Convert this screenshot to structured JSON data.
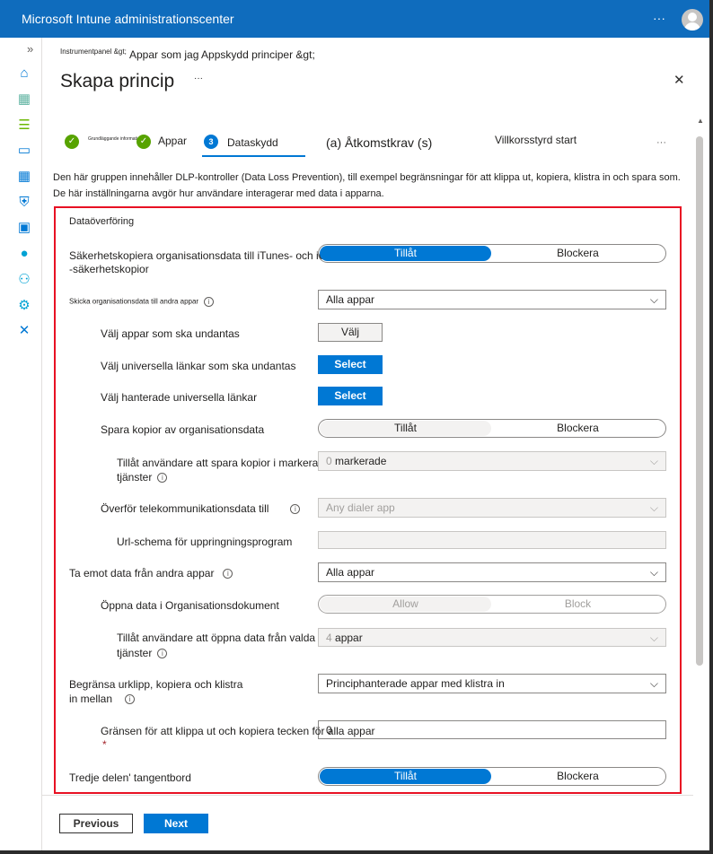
{
  "app": {
    "title": "Microsoft Intune administrationscenter",
    "more": "···"
  },
  "sidebar": {
    "expand": "»",
    "items": [
      "home-icon",
      "dashboard-icon",
      "all-services-icon",
      "devices-icon",
      "apps-icon",
      "endpoint-security-icon",
      "reports-icon",
      "users-icon",
      "groups-icon",
      "tenant-admin-icon",
      "troubleshooting-icon"
    ]
  },
  "breadcrumb": {
    "root": "Instrumentpanel &gt;",
    "path": "Appar som jag Appskydd principer &gt;"
  },
  "page": {
    "title": "Skapa princip",
    "more": "···",
    "close": "✕"
  },
  "steps": [
    {
      "label": "Grundläggande information",
      "state": "done"
    },
    {
      "label": "Appar",
      "state": "done"
    },
    {
      "number": "3",
      "label": "Dataskydd",
      "state": "current"
    },
    {
      "label": "(a)  Åtkomstkrav (s)",
      "state": "pending"
    },
    {
      "label": "Villkorsstyrd start",
      "state": "pending"
    }
  ],
  "steps_more": "···",
  "description": "Den här gruppen innehåller DLP-kontroller (Data Loss Prevention), till exempel begränsningar för att klippa ut, kopiera, klistra in och spara som. De här inställningarna avgör hur användare interagerar med data i apparna.",
  "section": {
    "title": "Dataöverföring"
  },
  "settings": {
    "backup": {
      "label1": "Säkerhetskopiera organisationsdata till iTunes- och iCloud",
      "label2": "-säkerhetskopior",
      "allow": "Tillåt",
      "block": "Blockera",
      "selected": "allow"
    },
    "send": {
      "label": "Skicka organisationsdata till andra appar",
      "value": "Alla appar"
    },
    "exempt": {
      "label": "Välj appar som ska undantas",
      "button": "Välj"
    },
    "universal": {
      "label": "Välj universella länkar som ska undantas",
      "button": "Select"
    },
    "managed": {
      "label": "Välj hanterade universella länkar",
      "button": "Select"
    },
    "save": {
      "label": "Spara kopior av organisationsdata",
      "allow": "Tillåt",
      "block": "Blockera",
      "selected": "allow"
    },
    "save_services": {
      "label1": "Tillåt användare att spara kopior i markerade",
      "label2": "tjänster",
      "count": "0",
      "value": "markerade"
    },
    "telecom": {
      "label": "Överför telekommunikationsdata till",
      "value": "Any dialer app"
    },
    "url_scheme": {
      "label": "Url-schema för uppringningsprogram",
      "value": ""
    },
    "receive": {
      "label": "Ta emot data från andra appar",
      "value": "Alla appar"
    },
    "open": {
      "label": "Öppna data i Organisationsdokument",
      "allow": "Allow",
      "block": "Block",
      "selected": "allow"
    },
    "open_services": {
      "label1": "Tillåt användare att öppna data från valda",
      "label2": "tjänster",
      "count": "4",
      "value": "appar"
    },
    "clipboard": {
      "label1": "Begränsa urklipp, kopiera och klistra",
      "label2": "in mellan",
      "value": "Principhanterade appar med klistra in"
    },
    "limit": {
      "label": "Gränsen för att klippa ut och kopiera tecken för alla appar",
      "required": "*",
      "value": "0"
    },
    "keyboard": {
      "label": "Tredje delen' tangentbord",
      "allow": "Tillåt",
      "block": "Blockera",
      "selected": "allow"
    }
  },
  "footer": {
    "previous": "Previous",
    "next": "Next"
  },
  "colors": {
    "brand": "#0f6cbd",
    "accent": "#0078d4",
    "success": "#57a300",
    "highlight": "#e81123"
  }
}
